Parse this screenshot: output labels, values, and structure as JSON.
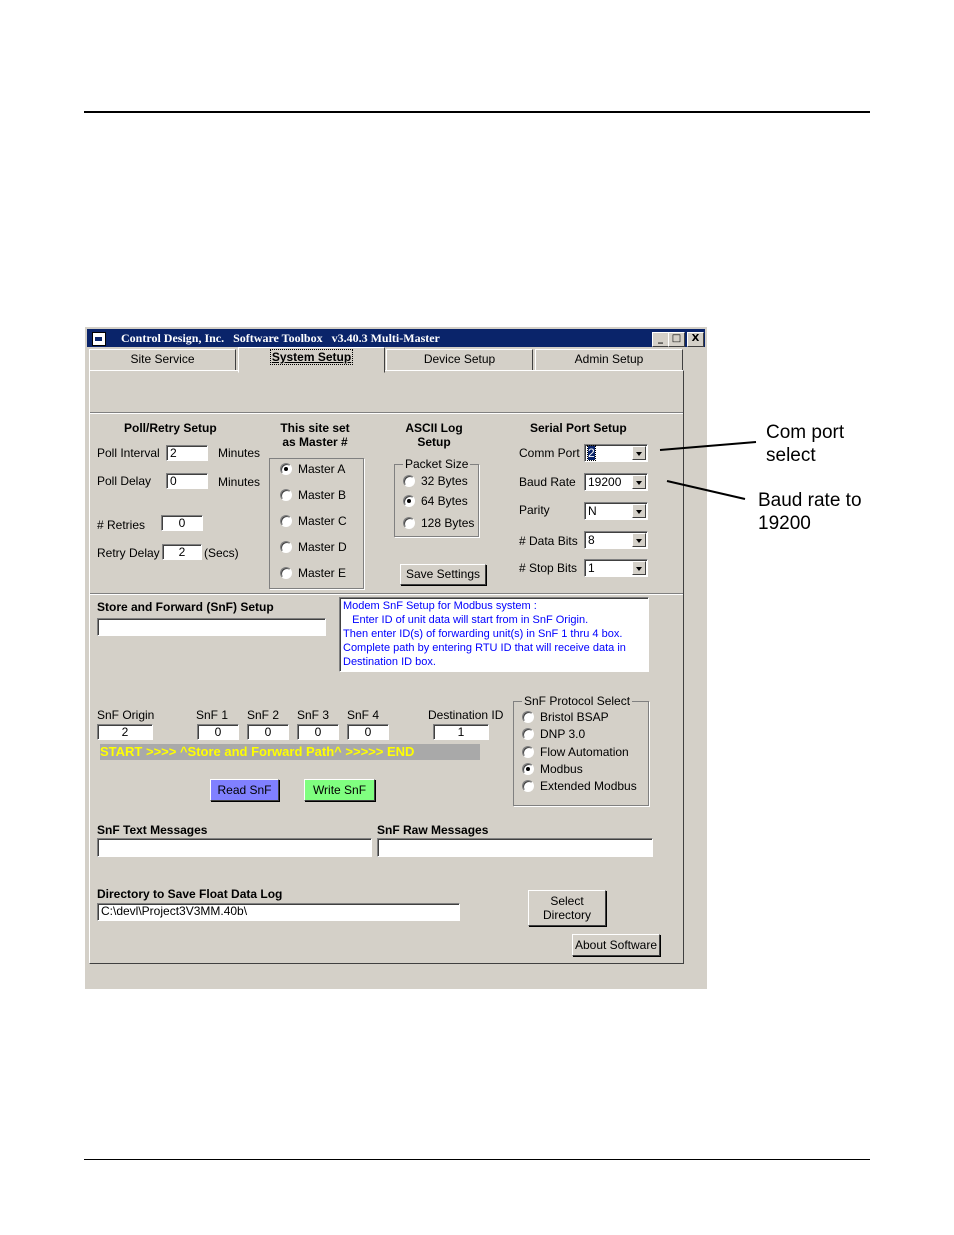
{
  "window": {
    "title": "Control Design, Inc.   Software Toolbox   v3.40.3 Multi-Master",
    "controls": {
      "minimize": "_",
      "maximize": "□",
      "close": "X"
    }
  },
  "tabs": [
    {
      "label": "Site Service",
      "active": false
    },
    {
      "label": "System Setup",
      "active": true
    },
    {
      "label": "Device Setup",
      "active": false
    },
    {
      "label": "Admin Setup",
      "active": false
    }
  ],
  "poll_retry": {
    "heading": "Poll/Retry Setup",
    "poll_interval_label": "Poll Interval",
    "poll_interval_value": "2",
    "poll_interval_unit": "Minutes",
    "poll_delay_label": "Poll Delay",
    "poll_delay_value": "0",
    "poll_delay_unit": "Minutes",
    "retries_label": "# Retries",
    "retries_value": "0",
    "retry_delay_label": "Retry Delay",
    "retry_delay_value": "2",
    "retry_delay_unit": "(Secs)"
  },
  "master": {
    "heading_line1": "This site set",
    "heading_line2": "as Master #",
    "options": [
      {
        "label": "Master A",
        "checked": true
      },
      {
        "label": "Master B",
        "checked": false
      },
      {
        "label": "Master C",
        "checked": false
      },
      {
        "label": "Master D",
        "checked": false
      },
      {
        "label": "Master E",
        "checked": false
      }
    ]
  },
  "ascii_log": {
    "heading_line1": "ASCII Log",
    "heading_line2": "Setup",
    "group_title": "Packet Size",
    "options": [
      {
        "label": "32 Bytes",
        "checked": false
      },
      {
        "label": "64 Bytes",
        "checked": true
      },
      {
        "label": "128 Bytes",
        "checked": false
      }
    ],
    "save_button": "Save Settings"
  },
  "serial_port": {
    "heading": "Serial Port Setup",
    "comm_port_label": "Comm Port",
    "comm_port_value": "2",
    "baud_rate_label": "Baud Rate",
    "baud_rate_value": "19200",
    "parity_label": "Parity",
    "parity_value": "N",
    "data_bits_label": "# Data Bits",
    "data_bits_value": "8",
    "stop_bits_label": "# Stop Bits",
    "stop_bits_value": "1"
  },
  "snf": {
    "heading": "Store and Forward (SnF) Setup",
    "setup_value": "",
    "note_lines": [
      "Modem SnF Setup for Modbus system :",
      "   Enter ID of unit data will start from in SnF Origin.",
      "Then enter ID(s) of forwarding unit(s) in SnF 1 thru 4 box.",
      "Complete path by entering RTU ID that will receive data in",
      "Destination ID box."
    ],
    "origin_label": "SnF Origin",
    "origin_value": "2",
    "snf1_label": "SnF 1",
    "snf1_value": "0",
    "snf2_label": "SnF 2",
    "snf2_value": "0",
    "snf3_label": "SnF 3",
    "snf3_value": "0",
    "snf4_label": "SnF 4",
    "snf4_value": "0",
    "destination_label": "Destination ID",
    "destination_value": "1",
    "path_banner": "START >>>> ^Store and Forward Path^ >>>>> END",
    "read_button": "Read SnF",
    "write_button": "Write SnF",
    "protocol_group_title": "SnF Protocol Select",
    "protocols": [
      {
        "label": "Bristol BSAP",
        "checked": false
      },
      {
        "label": "DNP 3.0",
        "checked": false
      },
      {
        "label": "Flow Automation",
        "checked": false
      },
      {
        "label": "Modbus",
        "checked": true
      },
      {
        "label": "Extended Modbus",
        "checked": false
      }
    ],
    "text_messages_label": "SnF Text Messages",
    "text_messages_value": "",
    "raw_messages_label": "SnF Raw Messages",
    "raw_messages_value": ""
  },
  "directory": {
    "label": "Directory to Save Float Data Log",
    "value": "C:\\devl\\Project3V3MM.40b\\",
    "select_button_line1": "Select",
    "select_button_line2": "Directory",
    "about_button": "About Software"
  },
  "annotations": {
    "com_port_line1": "Com port",
    "com_port_line2": "select",
    "baud_line1": "Baud rate to",
    "baud_line2": "19200"
  },
  "colors": {
    "titlebar": "#0a246a",
    "read_button": "#8080ff",
    "write_button": "#80ff80",
    "note_text": "#0000ff",
    "path_text": "#ffff00",
    "path_bg": "#a9a9a9"
  }
}
